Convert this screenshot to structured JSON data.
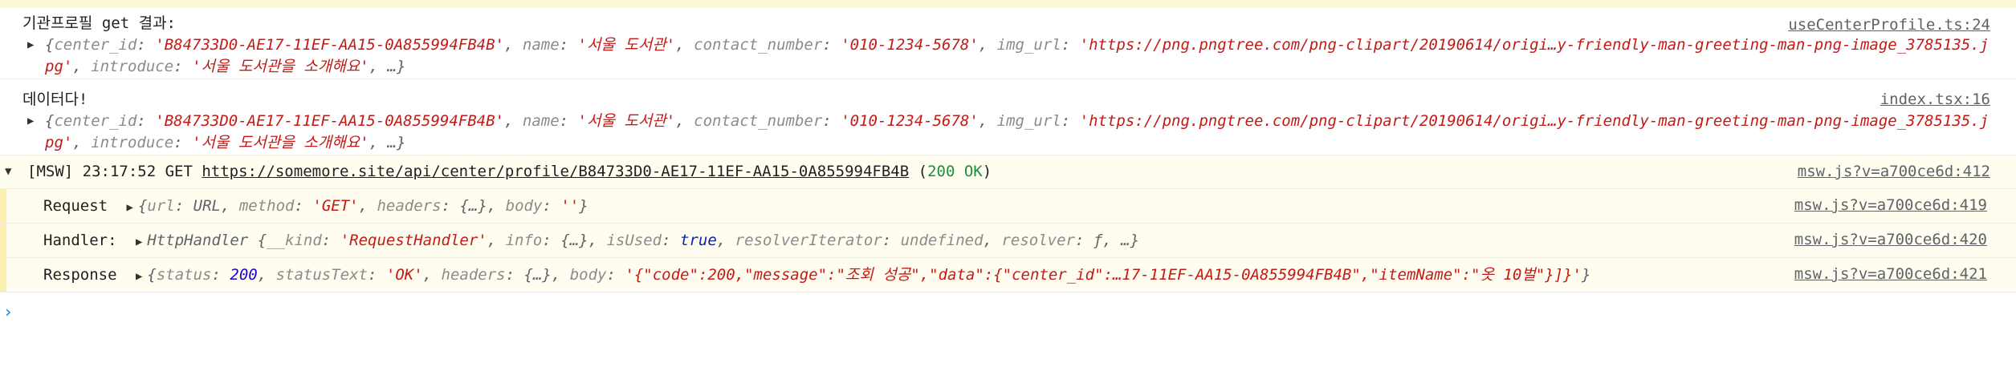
{
  "logs": [
    {
      "message": "기관프로필 get 결과:",
      "source": "useCenterProfile.ts:24",
      "object_line1_prefix": "{",
      "center_id_key": "center_id",
      "center_id_val": "'B84733D0-AE17-11EF-AA15-0A855994FB4B'",
      "name_key": "name",
      "name_val": "'서울 도서관'",
      "contact_key": "contact_number",
      "contact_val": "'010-1234-5678'",
      "img_key": "img_url",
      "img_val": "'https://png.pngtree.com/png-clipart/20190614/origi…y-friendly-man-greeting-man-png-image_3785135.jpg'",
      "introduce_key": "introduce",
      "introduce_val": "'서울 도서관을 소개해요'",
      "tail": ", …}"
    },
    {
      "message": "데이터다!",
      "source": "index.tsx:16",
      "object_line1_prefix": "{",
      "center_id_key": "center_id",
      "center_id_val": "'B84733D0-AE17-11EF-AA15-0A855994FB4B'",
      "name_key": "name",
      "name_val": "'서울 도서관'",
      "contact_key": "contact_number",
      "contact_val": "'010-1234-5678'",
      "img_key": "img_url",
      "img_val": "'https://png.pngtree.com/png-clipart/20190614/origi…y-friendly-man-greeting-man-png-image_3785135.jpg'",
      "introduce_key": "introduce",
      "introduce_val": "'서울 도서관을 소개해요'",
      "tail": ", …}"
    }
  ],
  "group": {
    "prefix": "[MSW] 23:17:52 GET",
    "url": "https://somemore.site/api/center/profile/B84733D0-AE17-11EF-AA15-0A855994FB4B",
    "status_open": "(",
    "status": "200 OK",
    "status_close": ")",
    "source": "msw.js?v=a700ce6d:412"
  },
  "request": {
    "label": "Request",
    "value_prefix": "{",
    "url_key": "url",
    "url_val": "URL",
    "method_key": "method",
    "method_val": "'GET'",
    "headers_key": "headers",
    "headers_val": "{…}",
    "body_key": "body",
    "body_val": "''",
    "close": "}",
    "source": "msw.js?v=a700ce6d:419"
  },
  "handler": {
    "label": "Handler:",
    "class_name": "HttpHandler",
    "open": "{",
    "kind_key": "__kind",
    "kind_val": "'RequestHandler'",
    "info_key": "info",
    "info_val": "{…}",
    "isUsed_key": "isUsed",
    "isUsed_val": "true",
    "resolverIterator_key": "resolverIterator",
    "resolverIterator_val": "undefined",
    "resolver_key": "resolver",
    "resolver_val": "ƒ",
    "tail": ", …}",
    "source": "msw.js?v=a700ce6d:420"
  },
  "response": {
    "label": "Response",
    "open": "{",
    "status_key": "status",
    "status_val": "200",
    "statusText_key": "statusText",
    "statusText_val": "'OK'",
    "headers_key": "headers",
    "headers_val": "{…}",
    "body_key": "body",
    "body_val": "'{\"code\":200,\"message\":\"조회 성공\",\"data\":{\"center_id\":…17-11EF-AA15-0A855994FB4B\",\"itemName\":\"옷 10벌\"}]}'",
    "close": "}",
    "source": "msw.js?v=a700ce6d:421"
  },
  "prompt_symbol": "›",
  "icons": {
    "expand": "expand-triangle-icon",
    "collapse": "collapse-triangle-icon",
    "prompt": "prompt-chevron-icon"
  },
  "colors": {
    "string": "#c41a16",
    "number": "#1c00cf",
    "key": "#8b8b8b",
    "ok": "#1e8e3e",
    "group_bg": "#fffdf0",
    "top_strip": "#fdf8d4"
  }
}
